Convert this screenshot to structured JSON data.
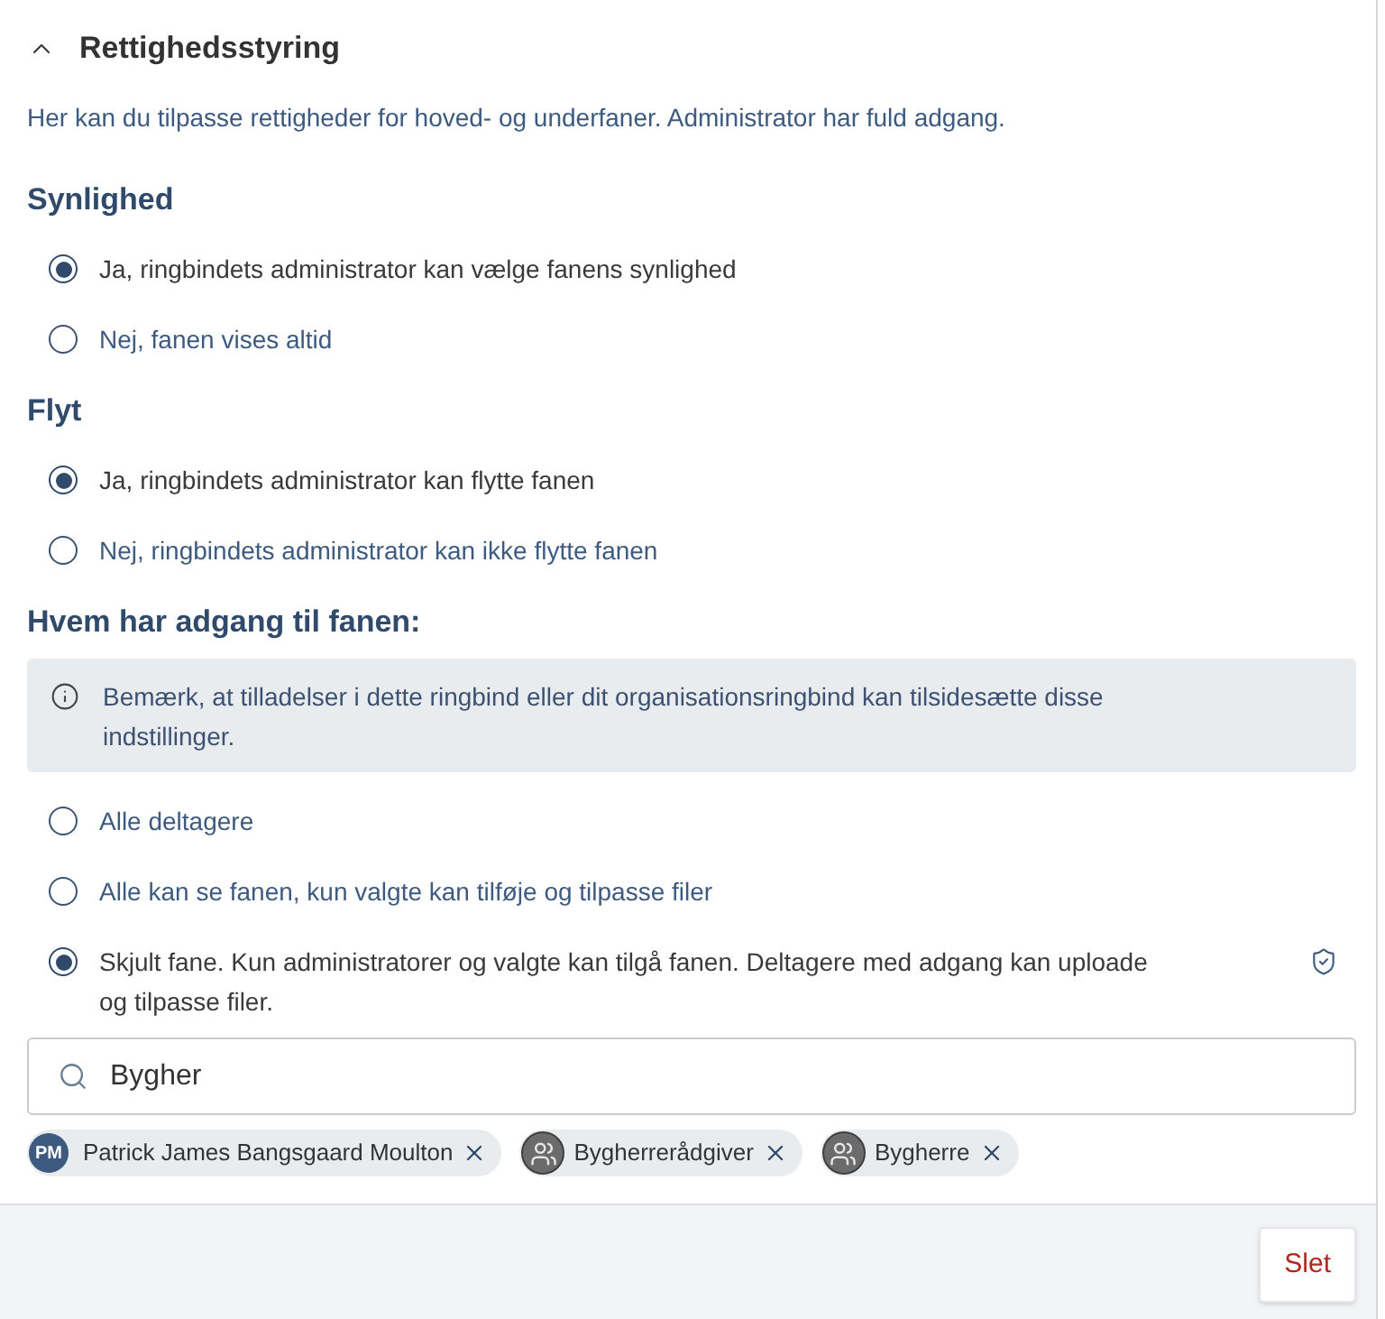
{
  "section": {
    "title": "Rettighedsstyring",
    "expanded": true,
    "description": "Her kan du tilpasse rettigheder for hoved- og underfaner. Administrator har fuld adgang."
  },
  "groups": [
    {
      "heading": "Synlighed",
      "options": [
        {
          "label": "Ja, ringbindets administrator kan vælge fanens synlighed",
          "selected": true
        },
        {
          "label": "Nej, fanen vises altid",
          "selected": false
        }
      ]
    },
    {
      "heading": "Flyt",
      "options": [
        {
          "label": "Ja, ringbindets administrator kan flytte fanen",
          "selected": true
        },
        {
          "label": "Nej, ringbindets administrator kan ikke flytte fanen",
          "selected": false
        }
      ]
    }
  ],
  "access": {
    "heading": "Hvem har adgang til fanen:",
    "notice": "Bemærk, at tilladelser i dette ringbind eller dit organisationsringbind kan tilsidesætte disse indstillinger.",
    "options": [
      {
        "label": "Alle deltagere",
        "selected": false,
        "restricted": false
      },
      {
        "label": "Alle kan se fanen, kun valgte kan tilføje og tilpasse filer",
        "selected": false,
        "restricted": false
      },
      {
        "label": "Skjult fane. Kun administratorer og valgte kan tilgå fanen. Deltagere med adgang kan uploade og tilpasse filer.",
        "selected": true,
        "restricted": true
      }
    ],
    "search": {
      "value": "Bygher"
    },
    "chips": [
      {
        "kind": "person",
        "initials": "PM",
        "label": "Patrick James Bangsgaard Moulton"
      },
      {
        "kind": "group",
        "label": "Bygherrerådgiver"
      },
      {
        "kind": "group",
        "label": "Bygherre"
      }
    ]
  },
  "footer": {
    "buttons": [
      {
        "label": "Slet",
        "kind": "danger"
      }
    ]
  }
}
